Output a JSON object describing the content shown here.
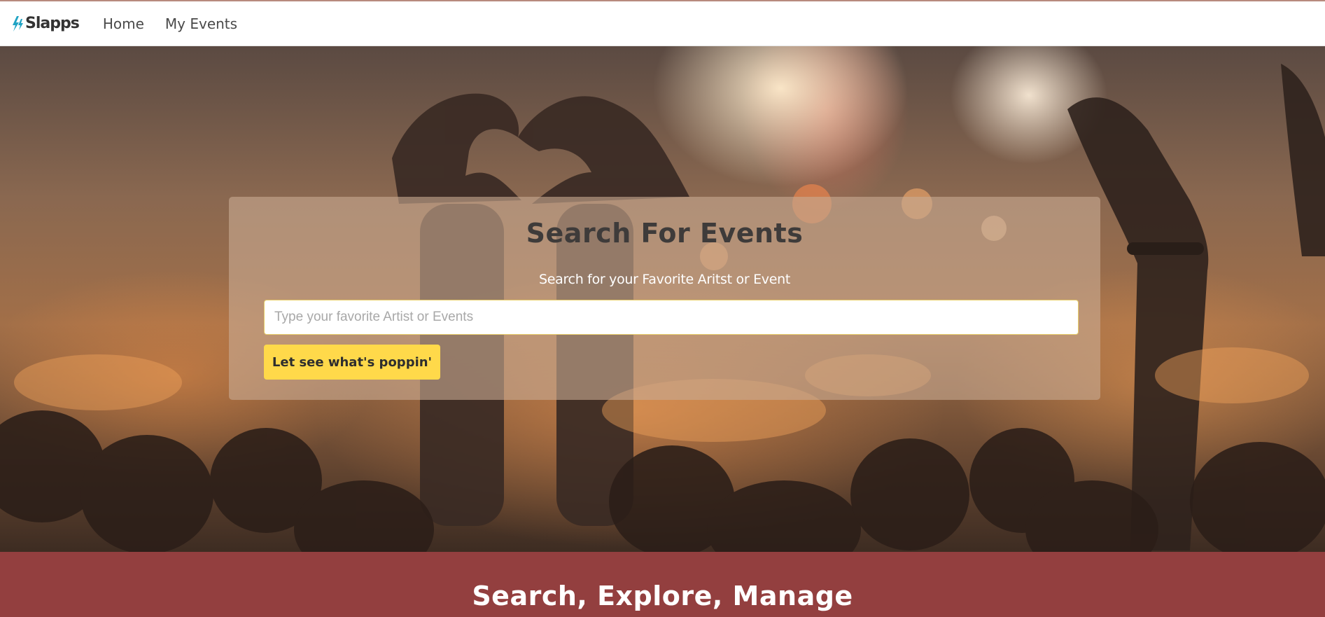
{
  "navbar": {
    "brand": "Slapps",
    "brand_icon": "bolt-logo-icon",
    "links": [
      {
        "label": "Home"
      },
      {
        "label": "My Events"
      }
    ]
  },
  "hero": {
    "background": "concert crowd photo",
    "search": {
      "title": "Search For Events",
      "subtitle": "Search for your Favorite Aritst or Event",
      "input_placeholder": "Type your favorite Artist or Events",
      "input_value": "",
      "button_label": "Let see what's poppin'"
    }
  },
  "banner": {
    "title": "Search, Explore, Manage"
  },
  "colors": {
    "navbar_bg": "#ffffff",
    "brand_accent": "#1fa3c4",
    "button_bg": "#ffd94a",
    "banner_bg": "#933f3f",
    "card_overlay": "#c8aa91"
  }
}
